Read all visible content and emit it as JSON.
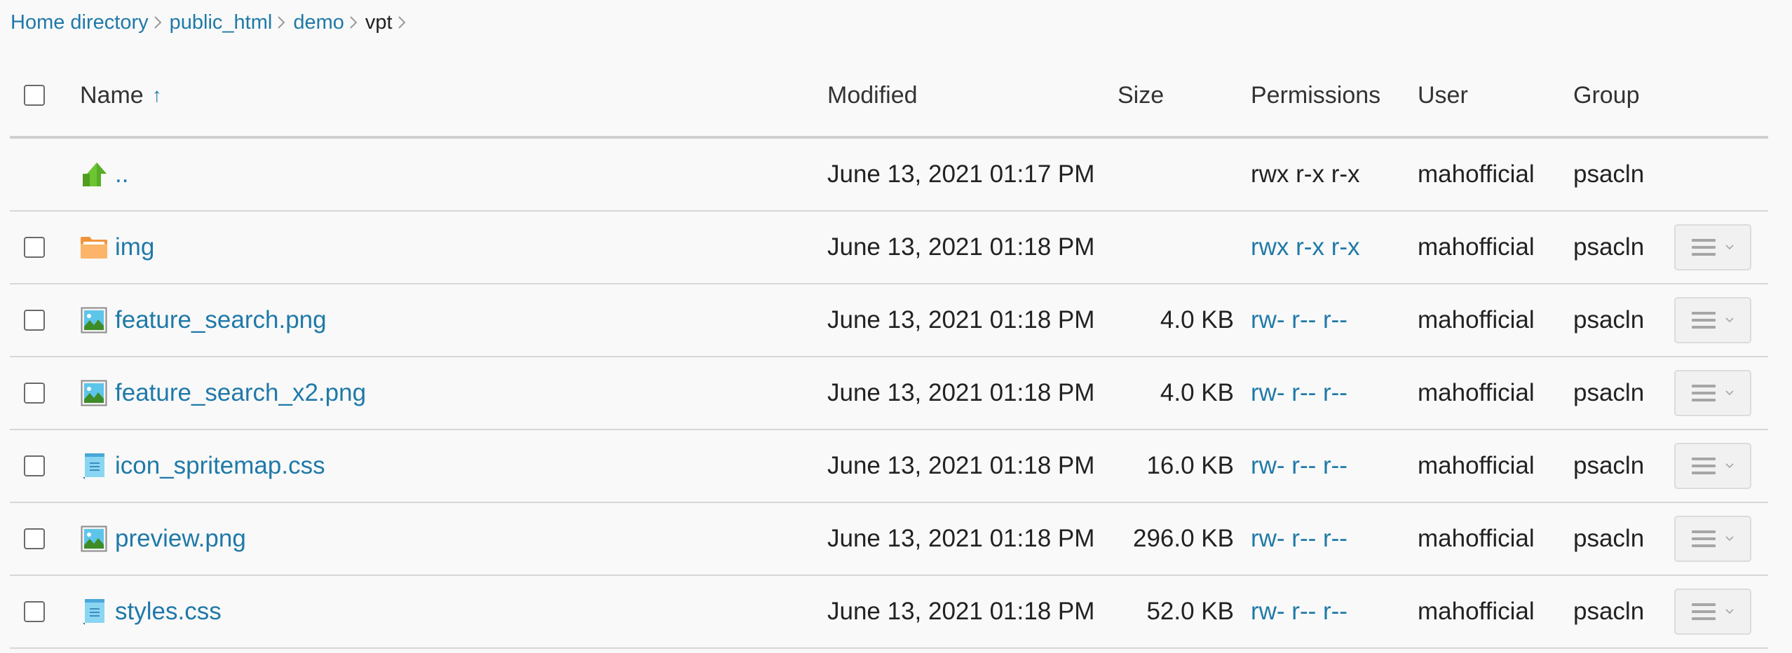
{
  "breadcrumb": {
    "items": [
      "Home directory",
      "public_html",
      "demo"
    ],
    "current": "vpt"
  },
  "table": {
    "columns": {
      "name": "Name",
      "sort_indicator": "↑",
      "modified": "Modified",
      "size": "Size",
      "permissions": "Permissions",
      "user": "User",
      "group": "Group"
    },
    "parent_row": {
      "name": "..",
      "icon": "folder-up-icon",
      "modified": "June 13, 2021 01:17 PM",
      "size": "",
      "permissions": "rwx r-x r-x",
      "user": "mahofficial",
      "group": "psacln"
    },
    "rows": [
      {
        "name": "img",
        "icon": "folder-icon",
        "modified": "June 13, 2021 01:18 PM",
        "size": "",
        "permissions": "rwx r-x r-x",
        "user": "mahofficial",
        "group": "psacln"
      },
      {
        "name": "feature_search.png",
        "icon": "image-file-icon",
        "modified": "June 13, 2021 01:18 PM",
        "size": "4.0 KB",
        "permissions": "rw- r-- r--",
        "user": "mahofficial",
        "group": "psacln"
      },
      {
        "name": "feature_search_x2.png",
        "icon": "image-file-icon",
        "modified": "June 13, 2021 01:18 PM",
        "size": "4.0 KB",
        "permissions": "rw- r-- r--",
        "user": "mahofficial",
        "group": "psacln"
      },
      {
        "name": "icon_spritemap.css",
        "icon": "text-file-icon",
        "modified": "June 13, 2021 01:18 PM",
        "size": "16.0 KB",
        "permissions": "rw- r-- r--",
        "user": "mahofficial",
        "group": "psacln"
      },
      {
        "name": "preview.png",
        "icon": "image-file-icon",
        "modified": "June 13, 2021 01:18 PM",
        "size": "296.0 KB",
        "permissions": "rw- r-- r--",
        "user": "mahofficial",
        "group": "psacln"
      },
      {
        "name": "styles.css",
        "icon": "text-file-icon",
        "modified": "June 13, 2021 01:18 PM",
        "size": "52.0 KB",
        "permissions": "rw- r-- r--",
        "user": "mahofficial",
        "group": "psacln"
      }
    ]
  },
  "colors": {
    "link": "#1f79a8",
    "folder": "#f7a35c",
    "up_arrow": "#5cb82a",
    "background": "#f9f9f9"
  }
}
